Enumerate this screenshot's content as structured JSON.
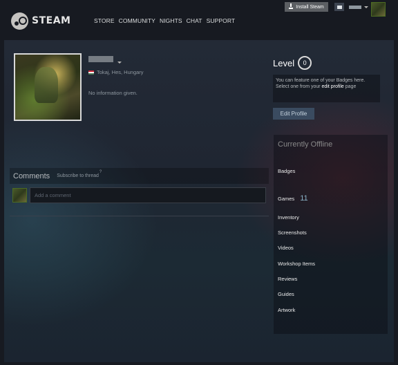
{
  "header": {
    "logo_text": "STEAM",
    "nav": [
      "STORE",
      "COMMUNITY",
      "NIGHTS",
      "CHAT",
      "SUPPORT"
    ],
    "install_label": "Install Steam"
  },
  "profile": {
    "location": "Tokaj, Hes, Hungary",
    "summary": "No information given.",
    "level_label": "Level",
    "level_value": "0",
    "badge_notice_line1": "You can feature one of your Badges here.",
    "badge_notice_line2_pre": "Select one from your ",
    "badge_notice_link": "edit profile",
    "badge_notice_line2_post": " page",
    "edit_profile_label": "Edit Profile"
  },
  "sidebar": {
    "status": "Currently Offline",
    "badges_label": "Badges",
    "games_label": "Games",
    "games_count": "11",
    "links": [
      "Inventory",
      "Screenshots",
      "Videos",
      "Workshop Items",
      "Reviews",
      "Guides",
      "Artwork"
    ]
  },
  "comments": {
    "title": "Comments",
    "subscribe_label": "Subscribe to thread",
    "help_mark": "?",
    "placeholder": "Add a comment"
  },
  "colors": {
    "flag_top": "#ce2939",
    "flag_mid": "#ffffff",
    "flag_bottom": "#477050",
    "games_count": "#8ab2c7"
  }
}
